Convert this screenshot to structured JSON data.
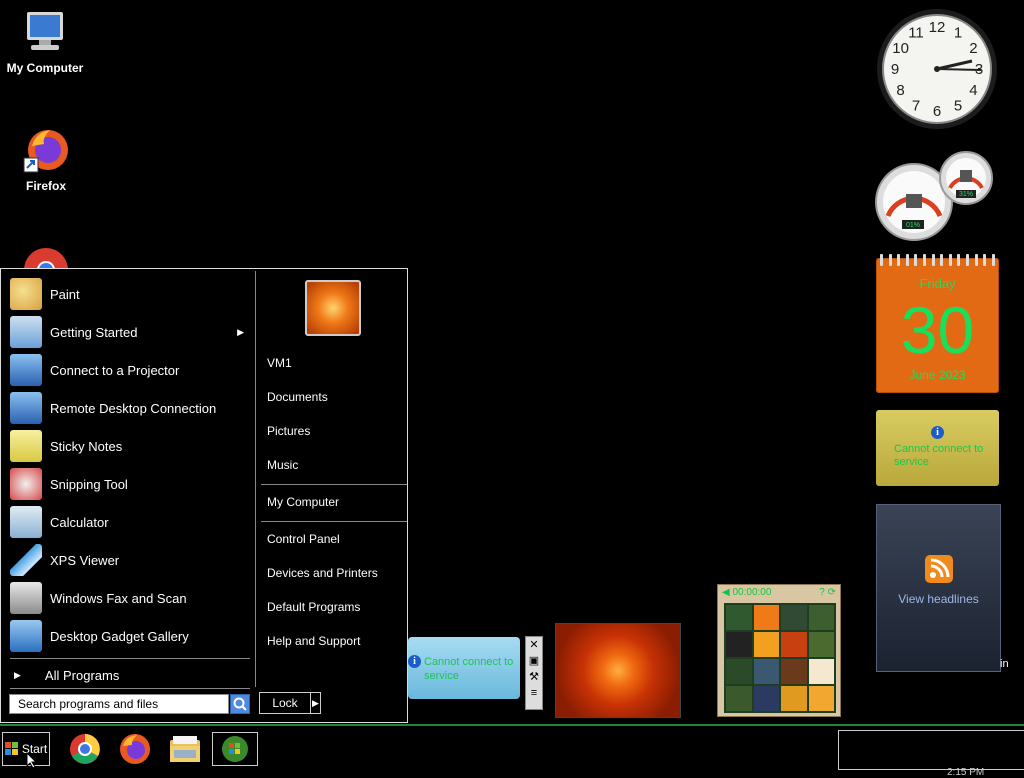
{
  "desktop": {
    "icons": [
      {
        "label": "My Computer",
        "icon": "computer-icon"
      },
      {
        "label": "Firefox",
        "icon": "firefox-icon"
      },
      {
        "label": "",
        "icon": "chrome-icon"
      }
    ]
  },
  "gadgets": {
    "clock": {
      "numbers": [
        "12",
        "1",
        "2",
        "3",
        "4",
        "5",
        "6",
        "7",
        "8",
        "9",
        "10",
        "11"
      ],
      "time": "2:15"
    },
    "cpu_meter": {
      "cpu": "01%",
      "memory": "31%"
    },
    "calendar": {
      "weekday": "Friday",
      "day": "30",
      "month_year": "June 2023"
    },
    "weather": {
      "message": "Cannot connect to service"
    },
    "feed": {
      "link": "View headlines",
      "side_text": "in"
    },
    "currency": {
      "message": "Cannot connect to service"
    },
    "puzzle": {
      "title": "00:00:00"
    }
  },
  "start_menu": {
    "programs": [
      {
        "label": "Paint",
        "icon": "paint-icon",
        "color": "#e8c050"
      },
      {
        "label": "Getting Started",
        "icon": "getting-started-icon",
        "color": "#6aa0d8",
        "has_submenu": true
      },
      {
        "label": "Connect to a Projector",
        "icon": "projector-icon",
        "color": "#3a78c8"
      },
      {
        "label": "Remote Desktop Connection",
        "icon": "remote-desktop-icon",
        "color": "#3a78c8"
      },
      {
        "label": "Sticky Notes",
        "icon": "sticky-notes-icon",
        "color": "#e0d858"
      },
      {
        "label": "Snipping Tool",
        "icon": "snipping-tool-icon",
        "color": "#d84848"
      },
      {
        "label": "Calculator",
        "icon": "calculator-icon",
        "color": "#8ab0d0"
      },
      {
        "label": "XPS Viewer",
        "icon": "xps-viewer-icon",
        "color": "#48a0e0"
      },
      {
        "label": "Windows Fax and Scan",
        "icon": "fax-scan-icon",
        "color": "#a0a0a0"
      },
      {
        "label": "Desktop Gadget Gallery",
        "icon": "gadget-gallery-icon",
        "color": "#4a8ad0"
      }
    ],
    "all_programs": "All Programs",
    "search_placeholder": "Search programs and files",
    "right_items": [
      "VM1",
      "Documents",
      "Pictures",
      "Music",
      "My Computer",
      "Control Panel",
      "Devices and Printers",
      "Default Programs",
      "Help and Support"
    ],
    "lock_label": "Lock"
  },
  "taskbar": {
    "start_label": "Start",
    "pinned": [
      "chrome-icon",
      "firefox-icon",
      "explorer-icon",
      "media-center-icon"
    ],
    "tray_time": "2:15 PM"
  }
}
